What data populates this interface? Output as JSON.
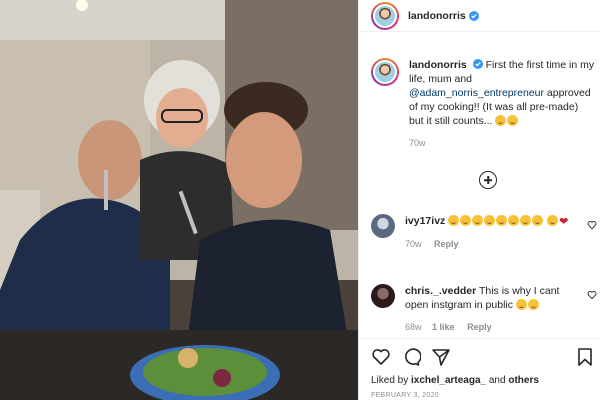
{
  "post": {
    "username": "landonorris",
    "caption_parts": [
      "First the first time in my life, mum and ",
      "@adam_norris_entrepreneur",
      " approved of my cooking!! (It was all pre-made) but it still counts..."
    ],
    "caption_time": "70w"
  },
  "comments": [
    {
      "user": "ivy17ivz",
      "time": "70w",
      "reply": "Reply"
    },
    {
      "user": "chris._.vedder",
      "text": "This is why I cant open instgram in public",
      "time": "68w",
      "likes": "1 like",
      "reply": "Reply"
    }
  ],
  "footer": {
    "liked_prefix": "Liked by ",
    "liked_user": "ixchel_arteaga_",
    "liked_mid": " and ",
    "liked_others": "others",
    "date": "FEBRUARY 3, 2020"
  },
  "colors": {
    "text": "#262626",
    "muted": "#8e8e8e",
    "link": "#00376b",
    "verified": "#3897f0",
    "heart": "#d6202a"
  },
  "icons": [
    "verified-badge-icon",
    "add-comment-icon",
    "heart-icon",
    "comment-icon",
    "share-icon",
    "save-icon"
  ]
}
